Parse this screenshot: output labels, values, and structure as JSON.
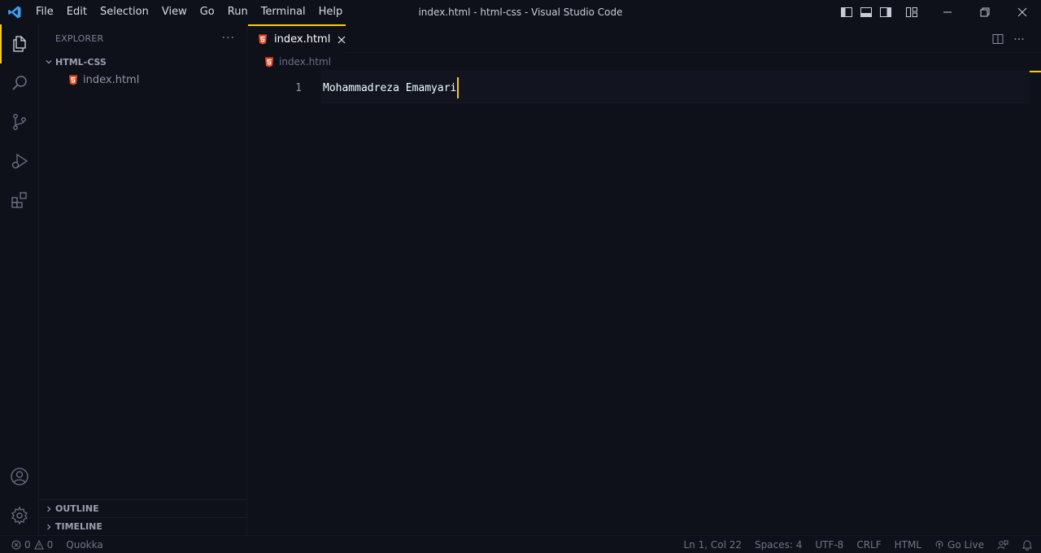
{
  "titlebar": {
    "menu": [
      "File",
      "Edit",
      "Selection",
      "View",
      "Go",
      "Run",
      "Terminal",
      "Help"
    ],
    "window_title": "index.html - html-css - Visual Studio Code"
  },
  "activitybar": {
    "top": [
      "files-icon",
      "search-icon",
      "source-control-icon",
      "run-debug-icon",
      "extensions-icon"
    ],
    "bottom": [
      "account-icon",
      "settings-gear-icon"
    ],
    "accent": "#ffcc00"
  },
  "sidebar": {
    "title": "EXPLORER",
    "more": "···",
    "folder": "HTML-CSS",
    "files": [
      {
        "name": "index.html",
        "icon": "html5-file-icon",
        "color": "#e44d26"
      }
    ],
    "outline": "OUTLINE",
    "timeline": "TIMELINE"
  },
  "editor": {
    "tab": {
      "label": "index.html"
    },
    "breadcrumb": "index.html",
    "lines": [
      {
        "number": "1",
        "text": "Mohammadreza Emamyari"
      }
    ]
  },
  "statusbar": {
    "errors": "0",
    "warnings": "0",
    "quokka": "Quokka",
    "position": "Ln 1, Col 22",
    "spaces": "Spaces: 4",
    "encoding": "UTF-8",
    "eol": "CRLF",
    "language": "HTML",
    "go_live": "Go Live"
  }
}
